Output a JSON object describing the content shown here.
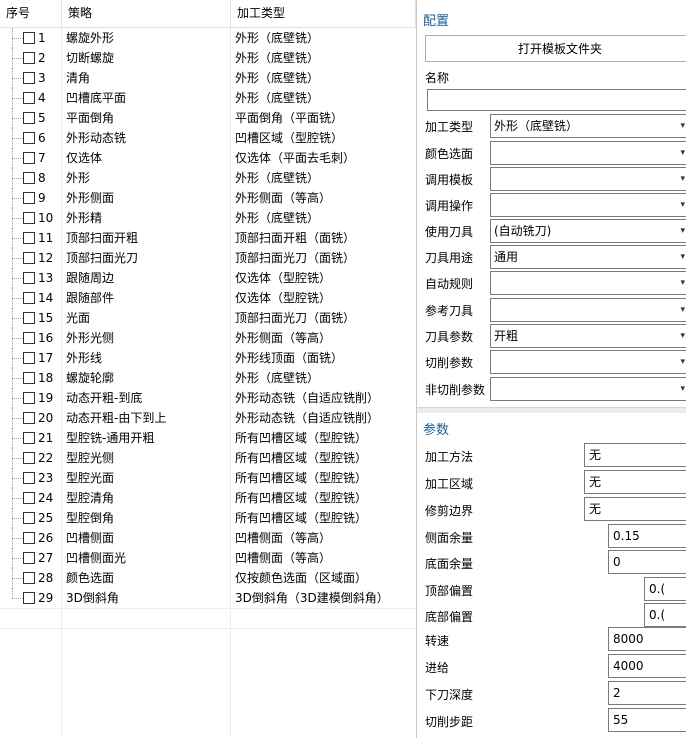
{
  "table": {
    "headers": {
      "no": "序号",
      "strategy": "策略",
      "type": "加工类型"
    },
    "rows": [
      {
        "no": "1",
        "strategy": "螺旋外形",
        "type": "外形（底壁铣）"
      },
      {
        "no": "2",
        "strategy": "切断螺旋",
        "type": "外形（底壁铣）"
      },
      {
        "no": "3",
        "strategy": "清角",
        "type": "外形（底壁铣）"
      },
      {
        "no": "4",
        "strategy": "凹槽底平面",
        "type": "外形（底壁铣）"
      },
      {
        "no": "5",
        "strategy": "平面倒角",
        "type": "平面倒角（平面铣）"
      },
      {
        "no": "6",
        "strategy": "外形动态铣",
        "type": "凹槽区域（型腔铣）"
      },
      {
        "no": "7",
        "strategy": "仅选体",
        "type": "仅选体（平面去毛刺）"
      },
      {
        "no": "8",
        "strategy": "外形",
        "type": "外形（底壁铣）"
      },
      {
        "no": "9",
        "strategy": "外形侧面",
        "type": "外形侧面（等高）"
      },
      {
        "no": "10",
        "strategy": "外形精",
        "type": "外形（底壁铣）"
      },
      {
        "no": "11",
        "strategy": "顶部扫面开粗",
        "type": "顶部扫面开粗（面铣）"
      },
      {
        "no": "12",
        "strategy": "顶部扫面光刀",
        "type": "顶部扫面光刀（面铣）"
      },
      {
        "no": "13",
        "strategy": "跟随周边",
        "type": "仅选体（型腔铣）"
      },
      {
        "no": "14",
        "strategy": "跟随部件",
        "type": "仅选体（型腔铣）"
      },
      {
        "no": "15",
        "strategy": "光面",
        "type": "顶部扫面光刀（面铣）"
      },
      {
        "no": "16",
        "strategy": "外形光侧",
        "type": "外形侧面（等高）"
      },
      {
        "no": "17",
        "strategy": "外形线",
        "type": "外形线顶面（面铣）"
      },
      {
        "no": "18",
        "strategy": "螺旋轮廓",
        "type": "外形（底壁铣）"
      },
      {
        "no": "19",
        "strategy": "动态开粗-到底",
        "type": "外形动态铣（自适应铣削）"
      },
      {
        "no": "20",
        "strategy": "动态开粗-由下到上",
        "type": "外形动态铣（自适应铣削）"
      },
      {
        "no": "21",
        "strategy": "型腔铣-通用开粗",
        "type": "所有凹槽区域（型腔铣）"
      },
      {
        "no": "22",
        "strategy": "型腔光侧",
        "type": "所有凹槽区域（型腔铣）"
      },
      {
        "no": "23",
        "strategy": "型腔光面",
        "type": "所有凹槽区域（型腔铣）"
      },
      {
        "no": "24",
        "strategy": "型腔清角",
        "type": "所有凹槽区域（型腔铣）"
      },
      {
        "no": "25",
        "strategy": "型腔倒角",
        "type": "所有凹槽区域（型腔铣）"
      },
      {
        "no": "26",
        "strategy": "凹槽侧面",
        "type": "凹槽侧面（等高）"
      },
      {
        "no": "27",
        "strategy": "凹槽侧面光",
        "type": "凹槽侧面（等高）"
      },
      {
        "no": "28",
        "strategy": "颜色选面",
        "type": "仅按颜色选面（区域面）"
      },
      {
        "no": "29",
        "strategy": "3D倒斜角",
        "type": "3D倒斜角（3D建模倒斜角）"
      }
    ]
  },
  "config": {
    "title": "配置",
    "open_template_button": "打开模板文件夹",
    "name_label": "名称",
    "name_value": "",
    "fields": [
      {
        "key": "process-type",
        "label": "加工类型",
        "value": "外形（底壁铣）"
      },
      {
        "key": "color-select",
        "label": "颜色选面",
        "value": ""
      },
      {
        "key": "call-template",
        "label": "调用模板",
        "value": ""
      },
      {
        "key": "call-operation",
        "label": "调用操作",
        "value": ""
      },
      {
        "key": "use-tool",
        "label": "使用刀具",
        "value": "(自动铣刀)"
      },
      {
        "key": "tool-usage",
        "label": "刀具用途",
        "value": "通用"
      },
      {
        "key": "auto-rule",
        "label": "自动规则",
        "value": ""
      },
      {
        "key": "reference-tool",
        "label": "参考刀具",
        "value": ""
      },
      {
        "key": "tool-params",
        "label": "刀具参数",
        "value": "开粗"
      },
      {
        "key": "cut-params",
        "label": "切削参数",
        "value": ""
      },
      {
        "key": "non-cut-params",
        "label": "非切削参数",
        "value": ""
      }
    ]
  },
  "params": {
    "title": "参数",
    "fields": [
      {
        "key": "method",
        "label": "加工方法",
        "value": "无"
      },
      {
        "key": "region",
        "label": "加工区域",
        "value": "无"
      },
      {
        "key": "trim-boundary",
        "label": "修剪边界",
        "value": "无"
      },
      {
        "key": "side-stock",
        "label": "侧面余量",
        "value": "0.15"
      },
      {
        "key": "floor-stock",
        "label": "底面余量",
        "value": "0"
      },
      {
        "key": "top-offset",
        "label": "顶部偏置",
        "value": "0.("
      },
      {
        "key": "bottom-offset",
        "label": "底部偏置",
        "value": "0.("
      },
      {
        "key": "spindle-speed",
        "label": "转速",
        "value": "8000"
      },
      {
        "key": "feed",
        "label": "进给",
        "value": "4000"
      },
      {
        "key": "depth",
        "label": "下刀深度",
        "value": "2"
      },
      {
        "key": "step",
        "label": "切削步距",
        "value": "55"
      }
    ]
  }
}
